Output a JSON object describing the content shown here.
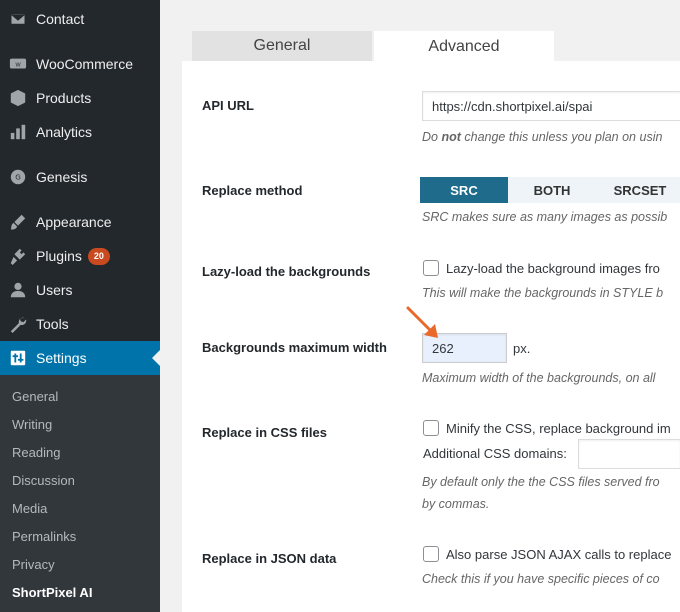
{
  "sidebar": {
    "menu": [
      {
        "label": "Contact",
        "icon": "mail-icon"
      },
      {
        "label": "WooCommerce",
        "icon": "woocommerce-icon"
      },
      {
        "label": "Products",
        "icon": "box-icon"
      },
      {
        "label": "Analytics",
        "icon": "bar-chart-icon"
      },
      {
        "label": "Genesis",
        "icon": "genesis-icon"
      },
      {
        "label": "Appearance",
        "icon": "paintbrush-icon"
      },
      {
        "label": "Plugins",
        "icon": "plug-icon",
        "badge": "20"
      },
      {
        "label": "Users",
        "icon": "user-icon"
      },
      {
        "label": "Tools",
        "icon": "wrench-icon"
      },
      {
        "label": "Settings",
        "icon": "settings-sliders-icon"
      }
    ],
    "submenu": [
      "General",
      "Writing",
      "Reading",
      "Discussion",
      "Media",
      "Permalinks",
      "Privacy",
      "ShortPixel AI"
    ]
  },
  "tabs": {
    "general": "General",
    "advanced": "Advanced"
  },
  "settings": {
    "api_url": {
      "label": "API URL",
      "value": "https://cdn.shortpixel.ai/spai",
      "desc_pre": "Do ",
      "desc_bold": "not",
      "desc_post": " change this unless you plan on usin"
    },
    "replace_method": {
      "label": "Replace method",
      "options": [
        "SRC",
        "BOTH",
        "SRCSET"
      ],
      "selected": "SRC",
      "desc": "SRC makes sure as many images as possib"
    },
    "lazy_bg": {
      "label": "Lazy-load the backgrounds",
      "checkbox_label": "Lazy-load the background images fro",
      "desc": "This will make the backgrounds in STYLE b"
    },
    "bg_max_width": {
      "label": "Backgrounds maximum width",
      "value": "262",
      "unit": "px.",
      "desc": "Maximum width of the backgrounds, on all"
    },
    "css_files": {
      "label": "Replace in CSS files",
      "checkbox_label": "Minify the CSS, replace background im",
      "domains_label": "Additional CSS domains:",
      "desc_line1": "By default only the the CSS files served fro",
      "desc_line2": "by commas."
    },
    "json_data": {
      "label": "Replace in JSON data",
      "checkbox_label": "Also parse JSON AJAX calls to replace",
      "desc": "Check this if you have specific pieces of co"
    }
  },
  "colors": {
    "accent": "#0073aa",
    "arrow": "#e8692a",
    "sidebar_bg": "#23282d",
    "segment_active": "#1e6b8c"
  }
}
